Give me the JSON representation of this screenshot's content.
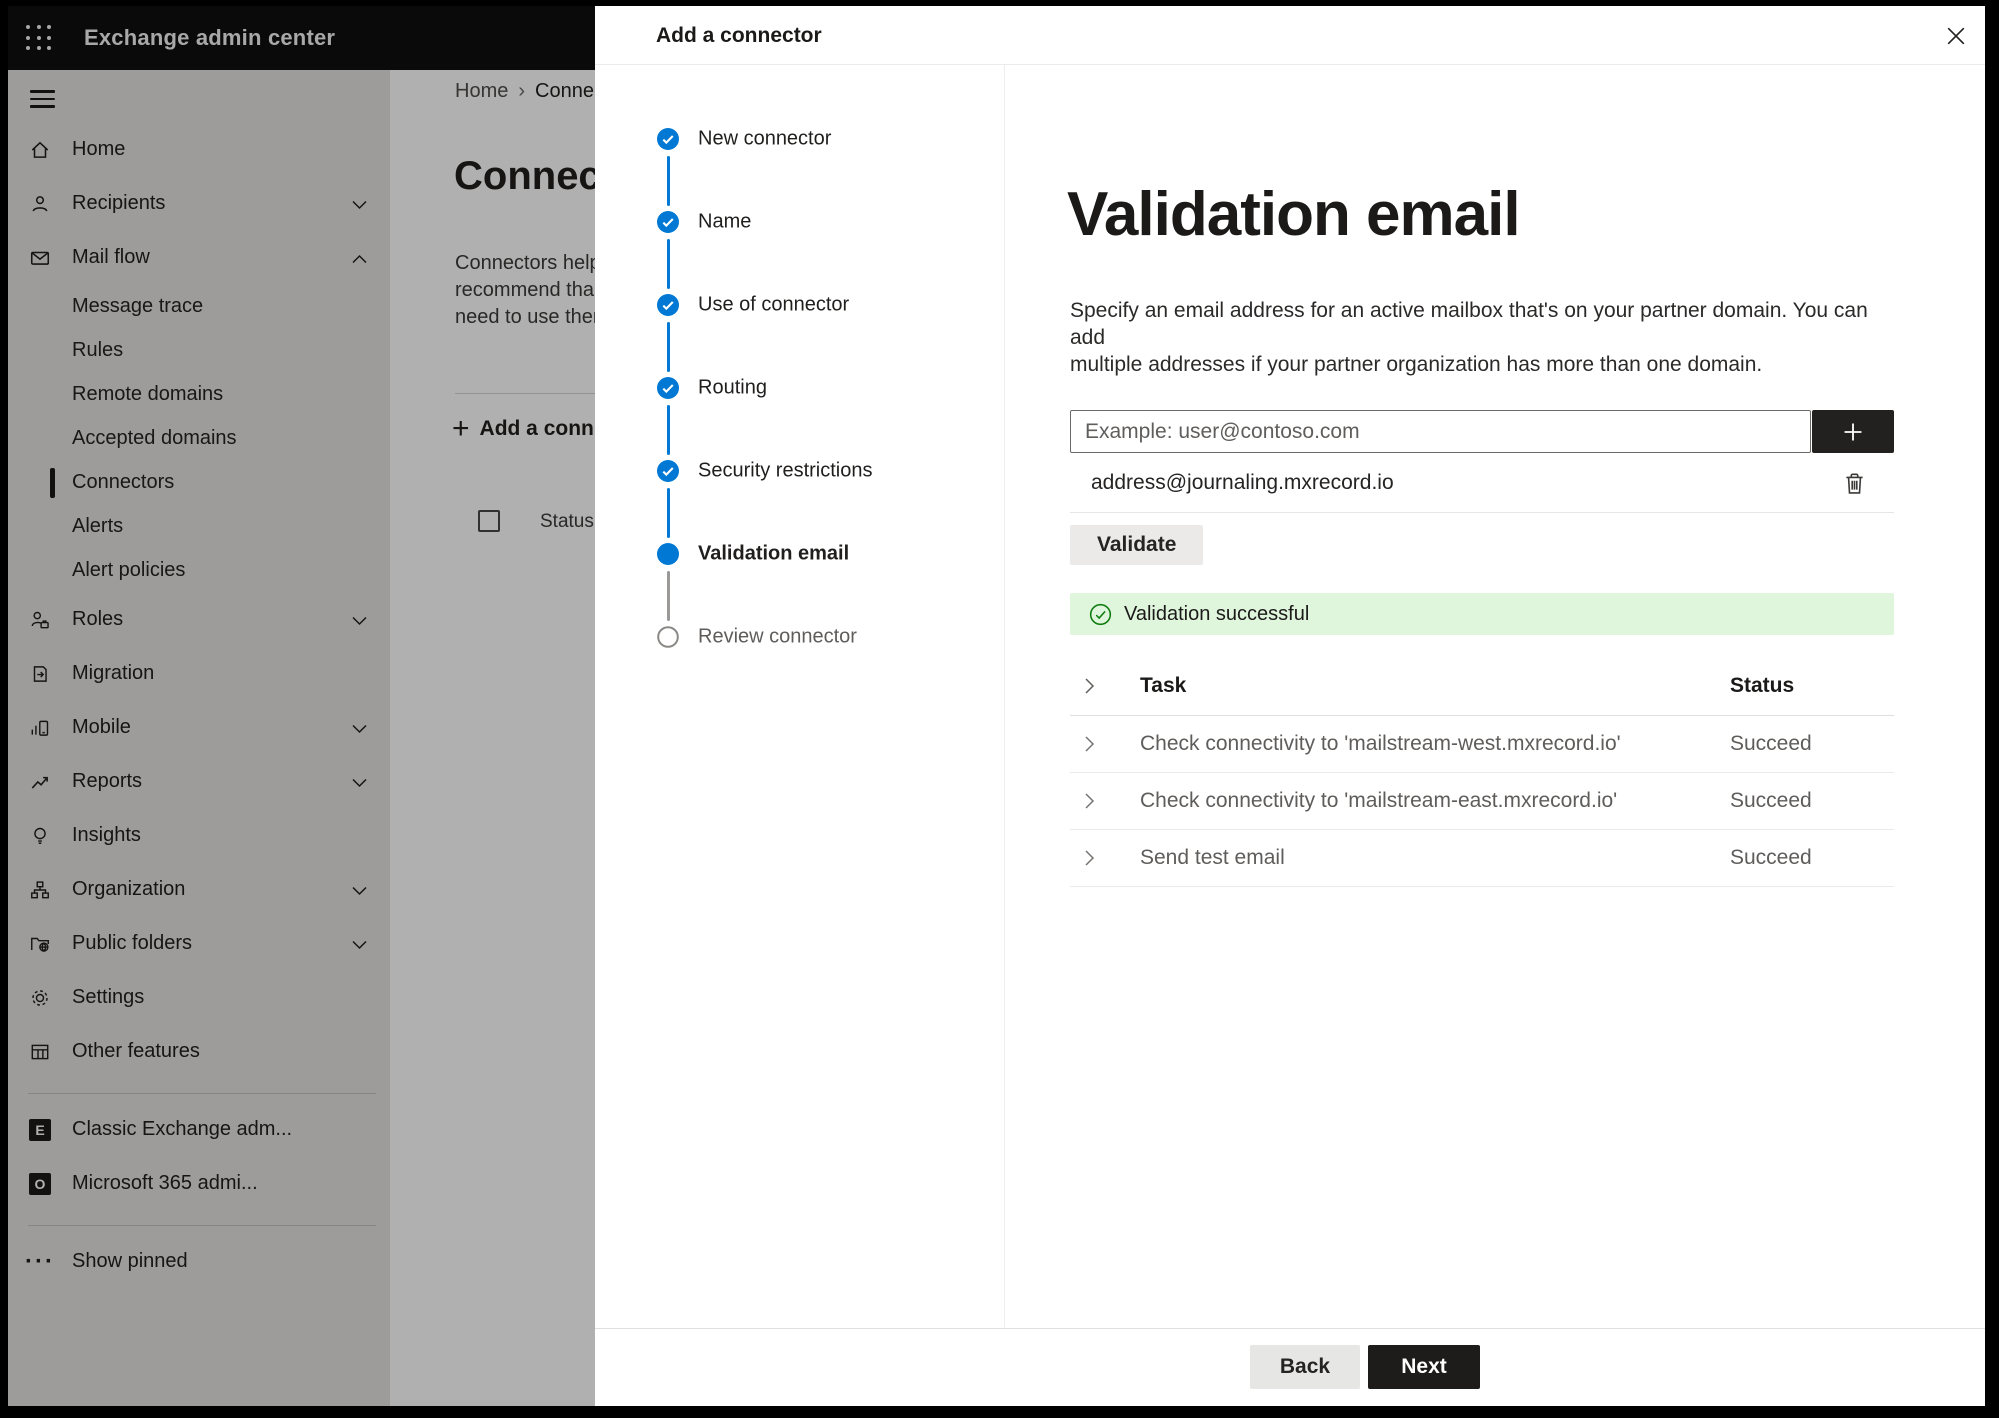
{
  "topbar": {
    "title": "Exchange admin center"
  },
  "sidebar": {
    "items": [
      {
        "label": "Home"
      },
      {
        "label": "Recipients",
        "chevron": "down"
      },
      {
        "label": "Mail flow",
        "chevron": "up"
      },
      {
        "label": "Message trace"
      },
      {
        "label": "Rules"
      },
      {
        "label": "Remote domains"
      },
      {
        "label": "Accepted domains"
      },
      {
        "label": "Connectors",
        "selected": true
      },
      {
        "label": "Alerts"
      },
      {
        "label": "Alert policies"
      },
      {
        "label": "Roles",
        "chevron": "down"
      },
      {
        "label": "Migration"
      },
      {
        "label": "Mobile",
        "chevron": "down"
      },
      {
        "label": "Reports",
        "chevron": "down"
      },
      {
        "label": "Insights"
      },
      {
        "label": "Organization",
        "chevron": "down"
      },
      {
        "label": "Public folders",
        "chevron": "down"
      },
      {
        "label": "Settings"
      },
      {
        "label": "Other features"
      },
      {
        "label": "Classic Exchange adm..."
      },
      {
        "label": "Microsoft 365 admi..."
      },
      {
        "label": "Show pinned"
      }
    ]
  },
  "background_page": {
    "breadcrumb": {
      "home": "Home",
      "separator": "›",
      "current": "Conne"
    },
    "title": "Connec",
    "description_lines": [
      "Connectors help",
      "recommend tha",
      "need to use ther"
    ],
    "add_button": "Add a conn",
    "add_plus": "+",
    "status_header": "Status"
  },
  "panel": {
    "title": "Add a connector",
    "steps": [
      {
        "label": "New connector",
        "state": "done"
      },
      {
        "label": "Name",
        "state": "done"
      },
      {
        "label": "Use of connector",
        "state": "done"
      },
      {
        "label": "Routing",
        "state": "done"
      },
      {
        "label": "Security restrictions",
        "state": "done"
      },
      {
        "label": "Validation email",
        "state": "active"
      },
      {
        "label": "Review connector",
        "state": "pending"
      }
    ],
    "content": {
      "heading": "Validation email",
      "description_line1": "Specify an email address for an active mailbox that's on your partner domain. You can add",
      "description_line2": "multiple addresses if your partner organization has more than one domain.",
      "email_input_placeholder": "Example: user@contoso.com",
      "added_address": "address@journaling.mxrecord.io",
      "validate_button": "Validate",
      "success_message": "Validation successful",
      "table": {
        "task_header": "Task",
        "status_header": "Status",
        "rows": [
          {
            "task": "Check connectivity to 'mailstream-west.mxrecord.io'",
            "status": "Succeed"
          },
          {
            "task": "Check connectivity to 'mailstream-east.mxrecord.io'",
            "status": "Succeed"
          },
          {
            "task": "Send test email",
            "status": "Succeed"
          }
        ]
      }
    },
    "footer": {
      "back": "Back",
      "next": "Next"
    }
  },
  "colors": {
    "accent": "#0078d4",
    "topbar": "#0f0f0f",
    "success_bg": "#dff6dd",
    "success_icon": "#107c10"
  }
}
